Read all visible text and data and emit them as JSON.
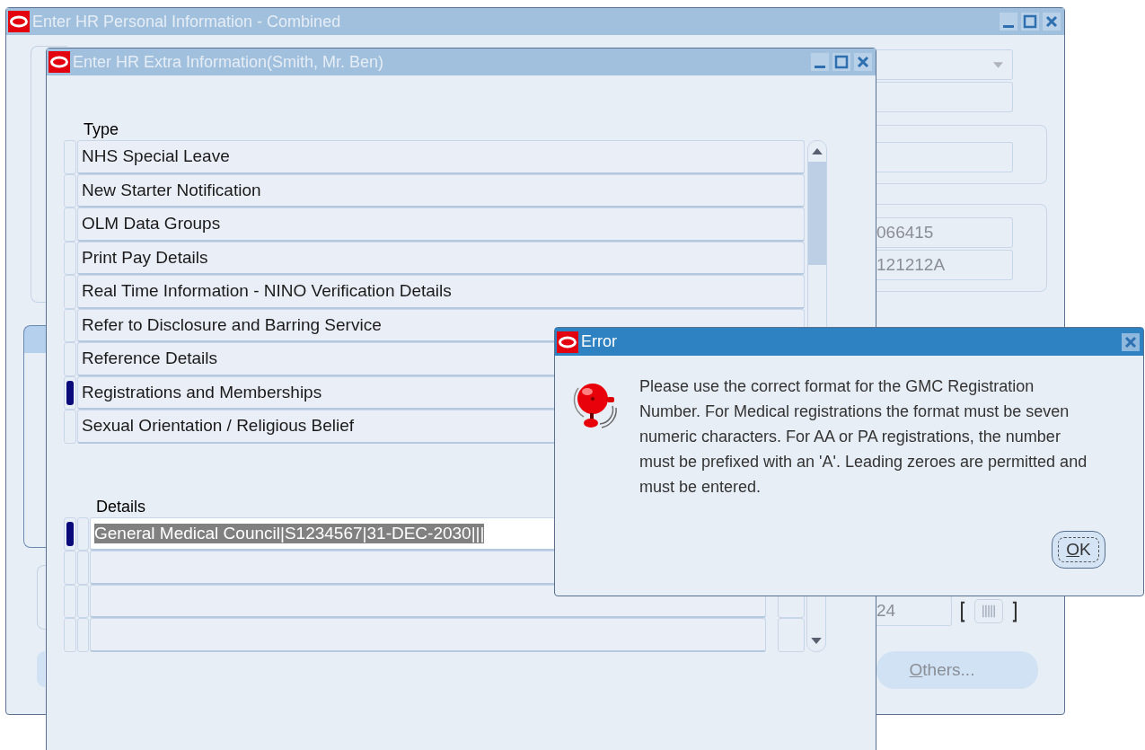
{
  "back_window": {
    "title": "Enter HR Personal Information - Combined",
    "fields": [
      "066415",
      "121212A"
    ],
    "date_field": "24",
    "others_button": "Others..."
  },
  "extra_window": {
    "title": "Enter HR Extra Information(Smith, Mr. Ben)",
    "type_label": "Type",
    "types": [
      {
        "label": "NHS Special Leave",
        "selected": false
      },
      {
        "label": "New Starter Notification",
        "selected": false
      },
      {
        "label": "OLM Data Groups",
        "selected": false
      },
      {
        "label": "Print Pay Details",
        "selected": false
      },
      {
        "label": "Real Time Information - NINO Verification Details",
        "selected": false
      },
      {
        "label": "Refer to Disclosure and Barring Service",
        "selected": false
      },
      {
        "label": "Reference Details",
        "selected": false
      },
      {
        "label": "Registrations and Memberships",
        "selected": true
      },
      {
        "label": "Sexual Orientation / Religious Belief",
        "selected": false
      }
    ],
    "details_label": "Details",
    "details": [
      {
        "value": "General Medical Council|S1234567|31-DEC-2030|||",
        "selected": true
      }
    ]
  },
  "error_dialog": {
    "title": "Error",
    "message": "Please use the correct format for the GMC Registration Number. For Medical registrations the format must be seven numeric characters.  For AA or PA registrations, the number must be prefixed with an 'A'. Leading zeroes are permitted and must be entered.",
    "ok_button": "OK"
  }
}
